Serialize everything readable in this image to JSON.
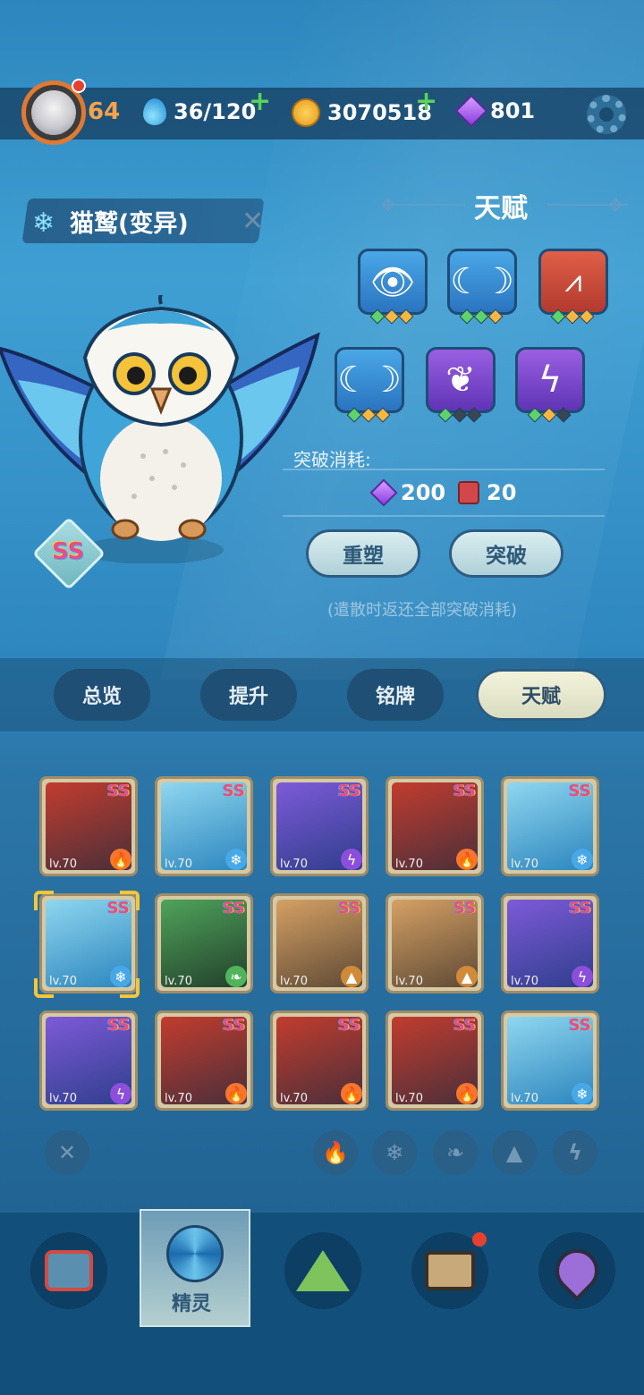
{
  "player": {
    "level": "64"
  },
  "resources": {
    "stamina": "36/120",
    "coins": "3070518",
    "gems": "801"
  },
  "spirit": {
    "name": "猫鹫(变异)",
    "rank": "SS"
  },
  "talent": {
    "title": "天赋",
    "skills_row1": [
      {
        "icon": "eye-icon",
        "color": "blue",
        "pips": [
          "g",
          "y",
          "y"
        ]
      },
      {
        "icon": "moons-icon",
        "color": "blue",
        "pips": [
          "g",
          "g",
          "y"
        ]
      },
      {
        "icon": "fang-icon",
        "color": "red",
        "pips": [
          "g",
          "y",
          "y"
        ]
      }
    ],
    "skills_row2": [
      {
        "icon": "moons-icon",
        "color": "blue",
        "pips": [
          "g",
          "y",
          "y"
        ]
      },
      {
        "icon": "wings-icon",
        "color": "purple",
        "pips": [
          "g",
          "d",
          "d"
        ]
      },
      {
        "icon": "bolt-icon",
        "color": "purple",
        "pips": [
          "g",
          "y",
          "d"
        ]
      }
    ],
    "cost_label": "突破消耗:",
    "cost_gems": "200",
    "cost_books": "20",
    "reset_button": "重塑",
    "breakthrough_button": "突破",
    "note": "(遣散时返还全部突破消耗)"
  },
  "tabs": [
    "总览",
    "提升",
    "铭牌",
    "天赋"
  ],
  "roster": [
    {
      "name": "bull-demon",
      "rank": "SS",
      "level": "lv.70",
      "element": "fire"
    },
    {
      "name": "crane",
      "rank": "SS",
      "level": "lv.70",
      "element": "ice"
    },
    {
      "name": "jellyfish",
      "rank": "SS",
      "level": "lv.70",
      "element": "bolt"
    },
    {
      "name": "red-dragon",
      "rank": "SS",
      "level": "lv.70",
      "element": "fire"
    },
    {
      "name": "ice-rabbit",
      "rank": "SS",
      "level": "lv.70",
      "element": "ice"
    },
    {
      "name": "owl",
      "rank": "SS",
      "level": "lv.70",
      "element": "ice"
    },
    {
      "name": "hooded-leaf",
      "rank": "SS",
      "level": "lv.70",
      "element": "leaf"
    },
    {
      "name": "clay-mask",
      "rank": "SS",
      "level": "lv.70",
      "element": "rock"
    },
    {
      "name": "skull-beast",
      "rank": "SS",
      "level": "lv.70",
      "element": "rock"
    },
    {
      "name": "purple-cat",
      "rank": "SS",
      "level": "lv.70",
      "element": "bolt"
    },
    {
      "name": "purple-dragon",
      "rank": "SS",
      "level": "lv.70",
      "element": "bolt"
    },
    {
      "name": "fire-imp",
      "rank": "SS",
      "level": "lv.70",
      "element": "fire"
    },
    {
      "name": "horned-blob",
      "rank": "SS",
      "level": "lv.70",
      "element": "fire"
    },
    {
      "name": "red-dragon-2",
      "rank": "SS",
      "level": "lv.70",
      "element": "fire"
    },
    {
      "name": "ice-rabbit-2",
      "rank": "SS",
      "level": "lv.70",
      "element": "ice"
    }
  ],
  "nav": {
    "active_label": "精灵"
  },
  "colors": {
    "accent_orange": "#f7a24a",
    "plus_green": "#5ad35a",
    "rank_pink": "#e84c8a"
  }
}
